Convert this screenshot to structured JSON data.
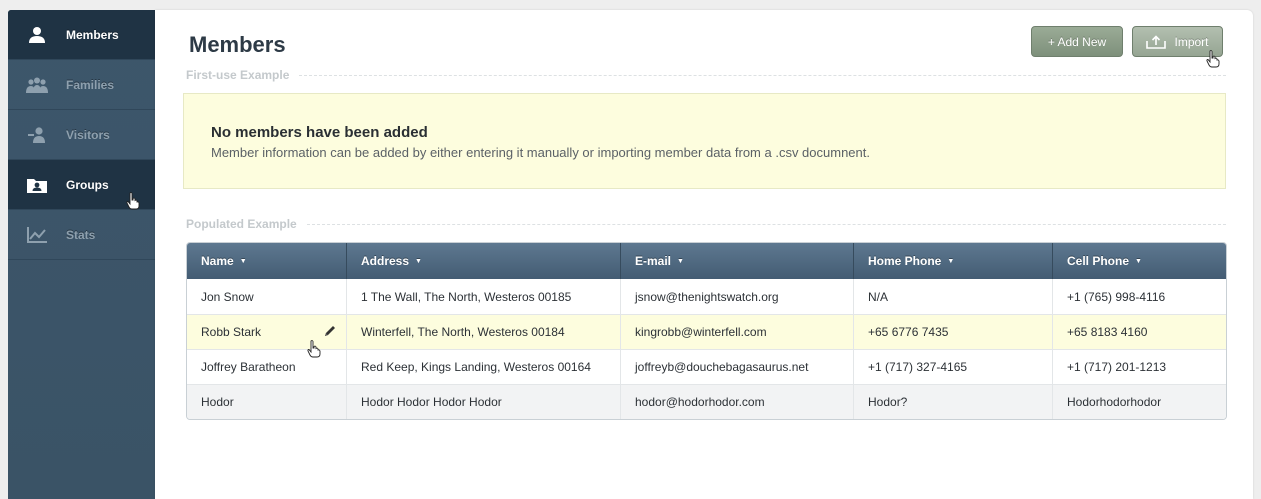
{
  "sidebar": {
    "items": [
      {
        "label": "Members",
        "icon": "user-icon"
      },
      {
        "label": "Families",
        "icon": "family-icon"
      },
      {
        "label": "Visitors",
        "icon": "visitor-icon"
      },
      {
        "label": "Groups",
        "icon": "group-folder-icon"
      },
      {
        "label": "Stats",
        "icon": "chart-icon"
      }
    ]
  },
  "header": {
    "title": "Members",
    "add_label": "+ Add New",
    "import_label": "Import"
  },
  "sections": {
    "first_use": "First-use Example",
    "populated": "Populated Example"
  },
  "notice": {
    "title": "No members have been added",
    "body": "Member information can be added by either entering it manually or importing member data from a .csv documnent."
  },
  "table": {
    "columns": [
      "Name",
      "Address",
      "E-mail",
      "Home Phone",
      "Cell Phone"
    ],
    "rows": [
      [
        "Jon Snow",
        "1 The Wall, The North, Westeros 00185",
        "jsnow@thenightswatch.org",
        "N/A",
        "+1 (765) 998-4116"
      ],
      [
        "Robb Stark",
        "Winterfell, The North, Westeros 00184",
        "kingrobb@winterfell.com",
        "+65 6776 7435",
        "+65 8183 4160"
      ],
      [
        "Joffrey Baratheon",
        "Red Keep, Kings Landing, Westeros 00164",
        "joffreyb@douchebagasaurus.net",
        "+1 (717) 327-4165",
        "+1 (717) 201-1213"
      ],
      [
        "Hodor",
        "Hodor Hodor Hodor Hodor",
        "hodor@hodorhodor.com",
        "Hodor?",
        "Hodorhodorhodor"
      ]
    ]
  },
  "colors": {
    "sidebar": "#3b5468",
    "sidebar_active": "#1f3344",
    "notice_bg": "#fdfdde",
    "table_header": "#4f687f",
    "button_green": "#8a9c86"
  }
}
